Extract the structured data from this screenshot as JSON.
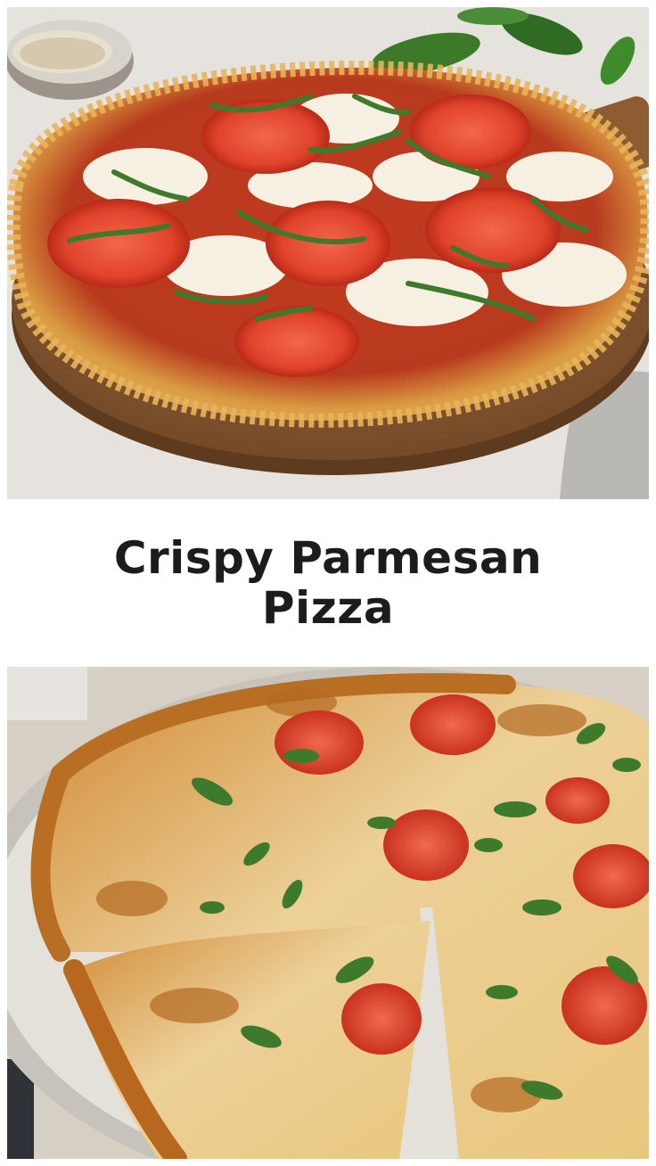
{
  "pin": {
    "title": "Crispy Parmesan Pizza"
  },
  "top_photo": {
    "subject": "parmesan-crust pizza with tomato slices, mozzarella and basil on a wooden board",
    "colors": {
      "background": "#e4e1dc",
      "board": "#8a5a33",
      "crust": "#d9a24a",
      "sauce": "#b8321e",
      "tomato": "#e0432b",
      "mozzarella": "#f4efe0",
      "basil": "#3f7a2c"
    }
  },
  "bottom_photo": {
    "subject": "sliced crispy parmesan pizza on a grey plate with one slice pulled out",
    "colors": {
      "plate": "#e6e3dd",
      "crust": "#c9822e",
      "cheese": "#f0d9a6",
      "tomato": "#d8452f",
      "basil": "#4a7e33"
    }
  }
}
